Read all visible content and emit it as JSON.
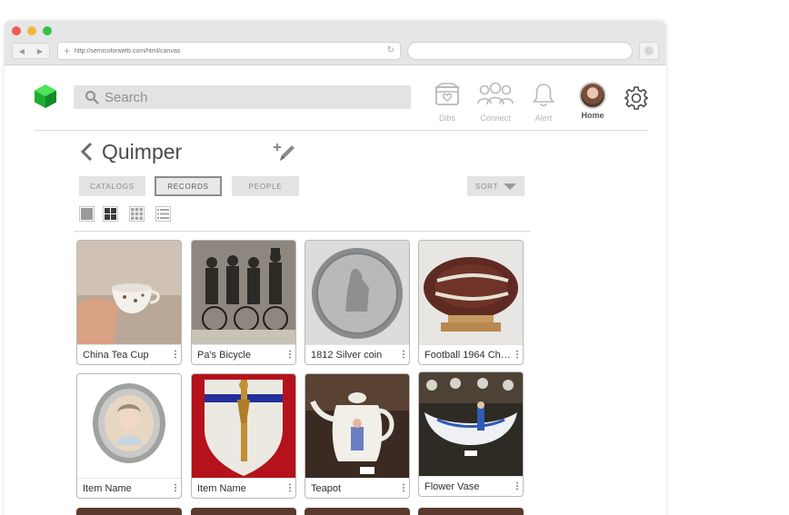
{
  "browser": {
    "url": "http://semicolonweb.com/html/canvas"
  },
  "header": {
    "search_placeholder": "Search",
    "nav": [
      {
        "label": "Dibs",
        "icon": "box-heart-icon"
      },
      {
        "label": "Connect",
        "icon": "people-icon"
      },
      {
        "label": "Alert",
        "icon": "bell-icon"
      },
      {
        "label": "Home",
        "icon": "avatar"
      }
    ],
    "settings_icon": "gear-icon"
  },
  "page": {
    "title": "Quimper",
    "tabs": [
      {
        "label": "CATALOGS",
        "active": false
      },
      {
        "label": "RECORDS",
        "active": true
      },
      {
        "label": "PEOPLE",
        "active": false
      }
    ],
    "sort_label": "SORT"
  },
  "items": [
    {
      "name": "China Tea Cup"
    },
    {
      "name": "Pa's Bicycle"
    },
    {
      "name": "1812 Silver coin"
    },
    {
      "name": "Football 1964 Cha..."
    },
    {
      "name": "Item Name"
    },
    {
      "name": "Item Name"
    },
    {
      "name": "Teapot"
    },
    {
      "name": "Flower Vase"
    }
  ],
  "colors": {
    "logo_green": "#2ecc40",
    "tab_bg": "#e3e3e3",
    "active_border": "#8c8c8c"
  }
}
